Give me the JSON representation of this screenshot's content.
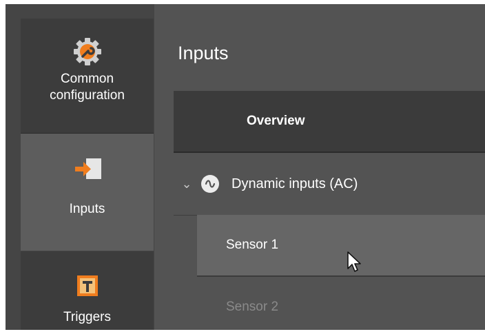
{
  "nav": {
    "items": [
      {
        "label": "Common\nconfiguration",
        "icon": "gear-wrench-icon",
        "selected": false
      },
      {
        "label": "Inputs",
        "icon": "input-arrow-icon",
        "selected": true
      },
      {
        "label": "Triggers",
        "icon": "trigger-t-icon",
        "selected": false
      }
    ]
  },
  "main": {
    "title": "Inputs",
    "overview_label": "Overview",
    "group": {
      "label": "Dynamic inputs (AC)",
      "icon": "ac-wave-icon",
      "expanded": true
    },
    "sensors": [
      {
        "label": "Sensor 1",
        "selected": true
      },
      {
        "label": "Sensor 2",
        "selected": false
      }
    ]
  },
  "colors": {
    "accent": "#f07d1e",
    "background": "#535353",
    "nav_background": "#3c3c3c"
  }
}
